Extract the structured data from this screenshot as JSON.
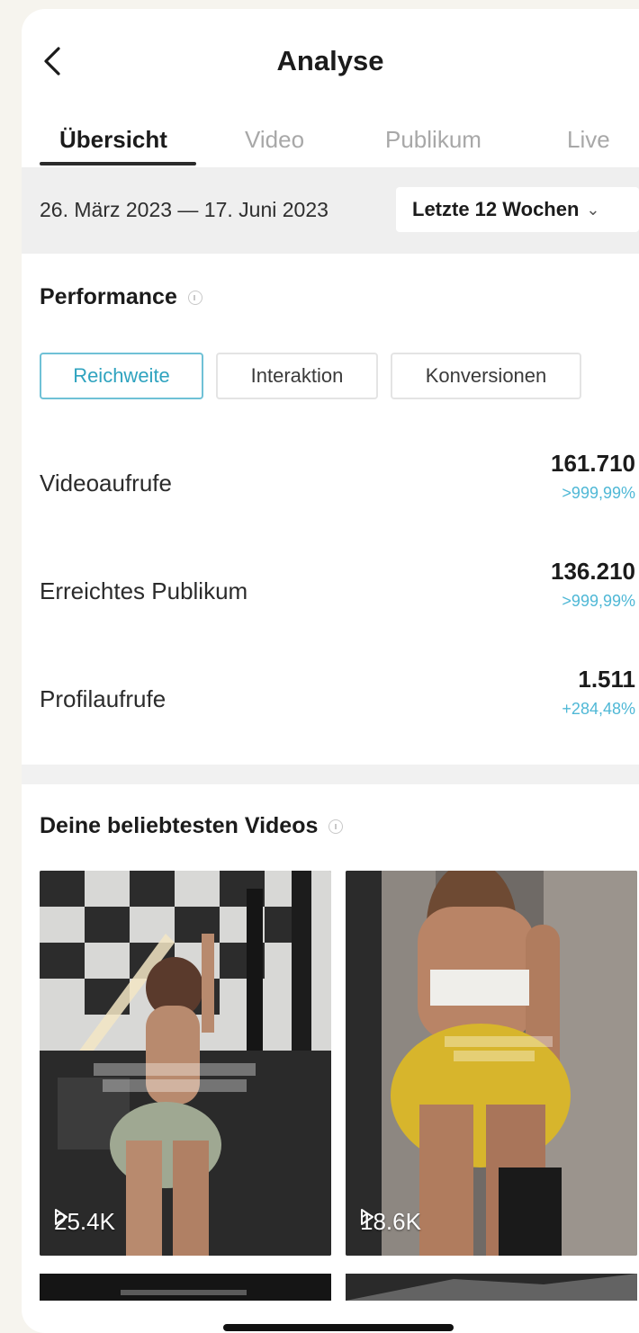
{
  "header": {
    "title": "Analyse",
    "back_icon": "chevron-left-icon"
  },
  "tabs": [
    {
      "label": "Übersicht",
      "active": true
    },
    {
      "label": "Video",
      "active": false
    },
    {
      "label": "Publikum",
      "active": false
    },
    {
      "label": "Live",
      "active": false
    }
  ],
  "date_bar": {
    "range": "26. März 2023 — 17. Juni 2023",
    "period_select": "Letzte 12 Wochen"
  },
  "performance": {
    "title": "Performance",
    "pills": [
      {
        "label": "Reichweite",
        "active": true
      },
      {
        "label": "Interaktion",
        "active": false
      },
      {
        "label": "Konversionen",
        "active": false
      }
    ],
    "metrics": [
      {
        "label": "Videoaufrufe",
        "value": "161.710",
        "change": ">999,99%"
      },
      {
        "label": "Erreichtes Publikum",
        "value": "136.210",
        "change": ">999,99%"
      },
      {
        "label": "Profilaufrufe",
        "value": "1.511",
        "change": "+284,48%"
      }
    ]
  },
  "top_videos": {
    "title": "Deine beliebtesten Videos",
    "videos": [
      {
        "views": "25.4K"
      },
      {
        "views": "18.6K"
      }
    ]
  },
  "colors": {
    "accent": "#2fa3bf",
    "change": "#4fb8d6",
    "accent_border": "#6fc1d6"
  }
}
